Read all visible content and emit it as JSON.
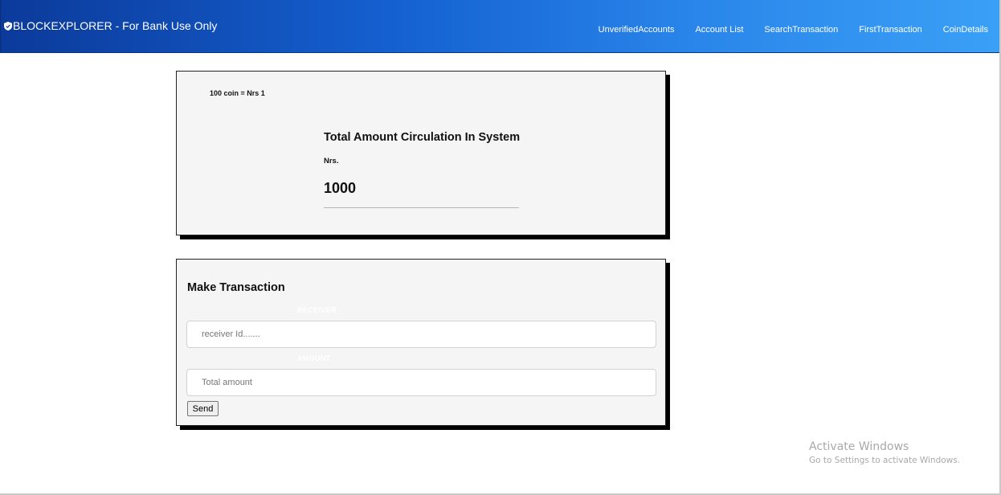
{
  "header": {
    "brand": "BLOCKEXPLORER - For Bank Use Only",
    "nav": [
      "UnverifiedAccounts",
      "Account List",
      "SearchTransaction",
      "FirstTransaction",
      "CoinDetails"
    ]
  },
  "circulation_card": {
    "rate": "100 coin = Nrs 1",
    "title": "Total Amount Circulation In System",
    "unit": "Nrs.",
    "value": "1000"
  },
  "transaction_card": {
    "title": "Make Transaction",
    "receiver_label": "RECEIVER",
    "receiver_placeholder": "receiver Id.......",
    "amount_label": "AMOUNT",
    "amount_placeholder": "Total amount",
    "send_label": "Send"
  },
  "watermark": {
    "title": "Activate Windows",
    "subtitle": "Go to Settings to activate Windows."
  },
  "colors": {
    "nav_gradient_start": "#0b3a9a",
    "nav_gradient_end": "#3aa0f6",
    "card_background": "#f4f5f4"
  }
}
